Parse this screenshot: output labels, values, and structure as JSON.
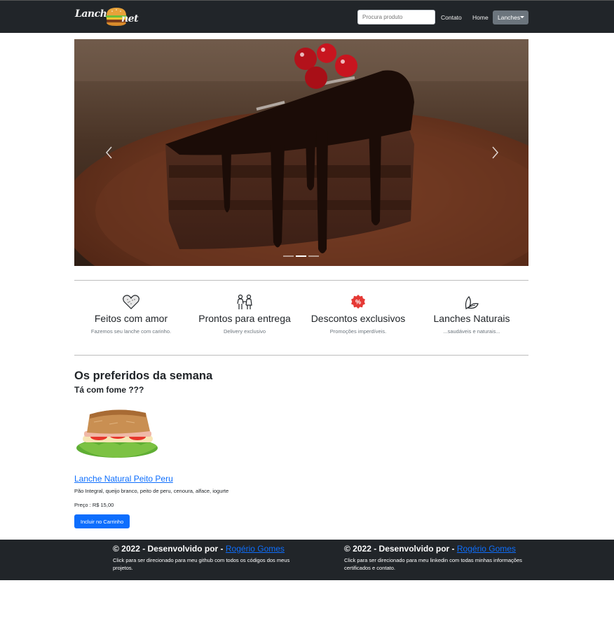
{
  "navbar": {
    "brand_left": "Lancho",
    "brand_right": "net",
    "search_placeholder": "Procura produto",
    "contato": "Contato",
    "home": "Home",
    "lanches": "Lanches"
  },
  "carousel": {
    "indicators": 3,
    "active_index": 1
  },
  "features": [
    {
      "title": "Feitos com amor",
      "subtitle": "Fazemos seu lanche com carinho.",
      "icon": "heart-icon"
    },
    {
      "title": "Prontos para entrega",
      "subtitle": "Delivery exclusivo",
      "icon": "people-icon"
    },
    {
      "title": "Descontos exclusivos",
      "subtitle": "Promoções imperdíveis.",
      "icon": "discount-icon"
    },
    {
      "title": "Lanches Naturais",
      "subtitle": "...saudáveis e naturais...",
      "icon": "leaf-icon"
    }
  ],
  "section": {
    "title": "Os preferidos da semana",
    "subtitle": "Tá com fome ???"
  },
  "product": {
    "name": "Lanche Natural Peito Peru",
    "description": "Pão Integral, queijo branco, peito de peru, cenoura, alface, iogurte",
    "price": "Preço : R$ 15,00",
    "button": "Incluir no Carrinho"
  },
  "footer": {
    "col1": {
      "prefix": "© 2022 - Desenvolvido por - ",
      "link": "Rogério Gomes",
      "text": "Click para ser direcionado para meu github com todos os códigos dos meus projetos."
    },
    "col2": {
      "prefix": "© 2022 - Desenvolvido por - ",
      "link": "Rogério Gomes",
      "text": "Click para ser direcionado para meu linkedin com todas minhas informações certificados e contato."
    }
  },
  "colors": {
    "navbar_bg": "#212529",
    "primary": "#0d6efd",
    "secondary": "#6c757d",
    "discount_badge": "#e53935"
  }
}
